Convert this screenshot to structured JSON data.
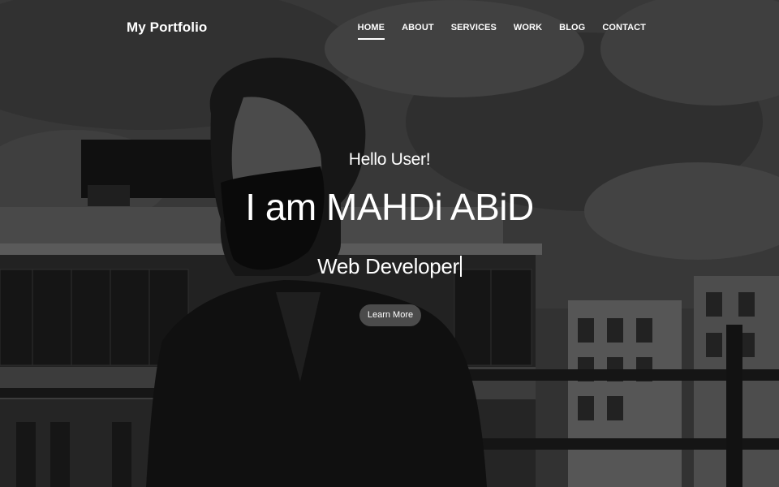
{
  "navbar": {
    "brand": "My Portfolio",
    "items": [
      {
        "label": "HOME",
        "active": true
      },
      {
        "label": "ABOUT",
        "active": false
      },
      {
        "label": "SERVICES",
        "active": false
      },
      {
        "label": "WORK",
        "active": false
      },
      {
        "label": "BLOG",
        "active": false
      },
      {
        "label": "CONTACT",
        "active": false
      }
    ]
  },
  "hero": {
    "greeting": "Hello User!",
    "name": "I am MAHDi ABiD",
    "role": "Web Developer",
    "cta_label": "Learn More"
  },
  "colors": {
    "text": "#ffffff",
    "button_bg": "#4b4b4b",
    "overlay": "#000000"
  }
}
